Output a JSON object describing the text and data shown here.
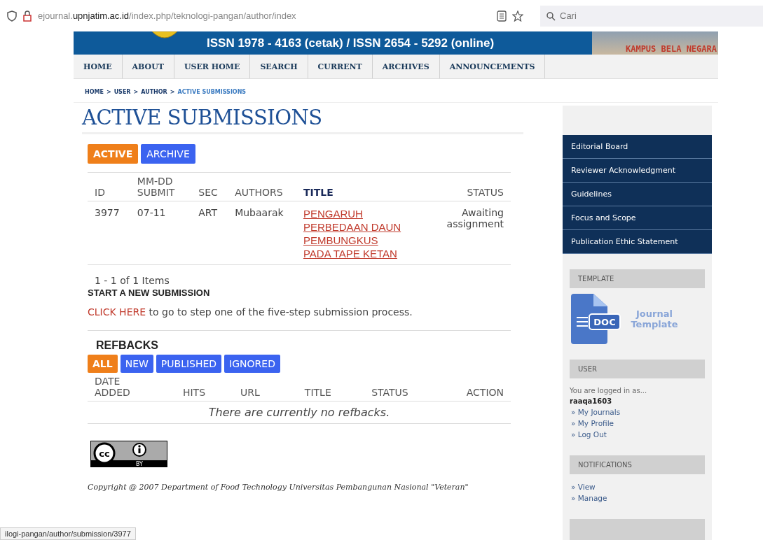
{
  "browser": {
    "url": "ejournal.**upnjatim.ac.id**/index.php/teknologi-pangan/author/index",
    "search": {
      "placeholder": "Cari"
    }
  },
  "banner": {
    "issn": "ISSN 1978 - 4163 (cetak) / ISSN 2654 - 5292 (online)",
    "tagline": "KAMPUS BELA NEGARA"
  },
  "nav": [
    "HOME",
    "ABOUT",
    "USER HOME",
    "SEARCH",
    "CURRENT",
    "ARCHIVES",
    "ANNOUNCEMENTS"
  ],
  "breadcrumb": {
    "separator": ">",
    "items": [
      {
        "label": "HOME",
        "current": false
      },
      {
        "label": "USER",
        "current": false
      },
      {
        "label": "AUTHOR",
        "current": false
      },
      {
        "label": "ACTIVE SUBMISSIONS",
        "current": true
      }
    ]
  },
  "page_title": "ACTIVE SUBMISSIONS",
  "submission_tabs": [
    {
      "label": "ACTIVE",
      "selected": true
    },
    {
      "label": "ARCHIVE",
      "selected": false
    }
  ],
  "submissions": {
    "columns": [
      {
        "label": "ID",
        "sorted": false
      },
      {
        "label": "MM-DD SUBMIT",
        "sorted": false
      },
      {
        "label": "SEC",
        "sorted": false
      },
      {
        "label": "AUTHORS",
        "sorted": false
      },
      {
        "label": "TITLE",
        "sorted": true
      },
      {
        "label": "STATUS",
        "sorted": false
      }
    ],
    "rows": [
      {
        "id": "3977",
        "submitted": "07-11",
        "section": "ART",
        "authors": "Mubaarak",
        "title": "PENGARUH PERBEDAAN DAUN PEMBUNGKUS PADA TAPE KETAN",
        "status": "Awaiting assignment"
      }
    ],
    "pager": "1 - 1 of 1 Items"
  },
  "new_submission": {
    "heading": "START A NEW SUBMISSION",
    "link": "CLICK HERE",
    "text": "to go to step one of the five-step submission process."
  },
  "refbacks": {
    "heading": "REFBACKS",
    "filters": [
      {
        "label": "ALL",
        "selected": true
      },
      {
        "label": "NEW",
        "selected": false
      },
      {
        "label": "PUBLISHED",
        "selected": false
      },
      {
        "label": "IGNORED",
        "selected": false
      }
    ],
    "columns": [
      "DATE ADDED",
      "HITS",
      "URL",
      "TITLE",
      "STATUS",
      "ACTION"
    ],
    "empty_message": "There are currently no refbacks."
  },
  "license": {
    "cc_label": "cc",
    "badge_label": "BY"
  },
  "copyright": "Copyright @ 2007 Department of Food Technology Universitas Pembangunan Nasional \"Veteran\"",
  "sidebar": {
    "menu": [
      "Editorial Board",
      "Reviewer Acknowledgment",
      "Guidelines",
      "Focus and Scope",
      "Publication Ethic Statement"
    ],
    "template": {
      "header": "TEMPLATE",
      "doc_label": "DOC",
      "link": "Journal Template"
    },
    "link_bullet": "»",
    "user": {
      "header": "USER",
      "logged_in_text": "You are logged in as...",
      "username": "raaqa1603",
      "links": [
        "My Journals",
        "My Profile",
        "Log Out"
      ]
    },
    "notifications": {
      "header": "NOTIFICATIONS",
      "links": [
        "View",
        "Manage"
      ]
    }
  },
  "status_bar": "ilogi-pangan/author/submission/3977"
}
